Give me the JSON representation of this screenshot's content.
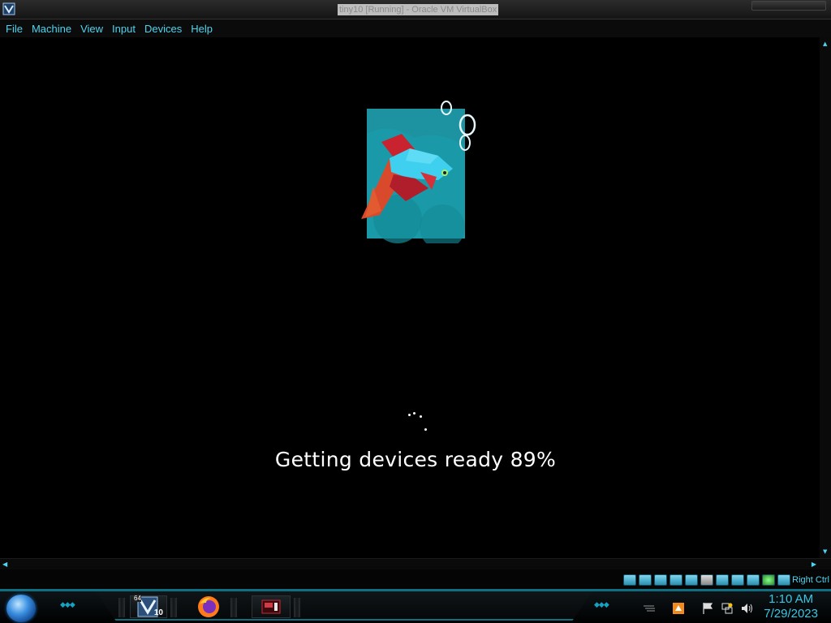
{
  "window": {
    "title": "tiny10 [Running] - Oracle VM VirtualBox",
    "app_icon": "virtualbox-icon"
  },
  "menubar": {
    "items": [
      "File",
      "Machine",
      "View",
      "Input",
      "Devices",
      "Help"
    ]
  },
  "vm_screen": {
    "artwork": "betta-fish-illustration",
    "status_text": "Getting devices ready 89%",
    "progress_percent": 89
  },
  "vbox_status": {
    "icons": [
      "hard-disk-icon",
      "optical-drive-icon",
      "audio-icon",
      "network-icon",
      "usb-icon",
      "shared-folder-icon",
      "display-icon",
      "recording-icon",
      "cpu-icon",
      "mouse-integration-icon",
      "keyboard-icon"
    ],
    "host_key": "Right Ctrl"
  },
  "taskbar": {
    "pinned": [
      {
        "name": "tiny10-64-icon",
        "badge_top": "64",
        "badge_bottom": "10"
      },
      {
        "name": "firefox-icon"
      },
      {
        "name": "media-player-icon"
      }
    ],
    "tray_icons": [
      "firefox-tray-icon",
      "flag-icon",
      "network-tray-icon",
      "volume-icon"
    ],
    "clock": {
      "time": "1:10 AM",
      "date": "7/29/2023"
    }
  },
  "colors": {
    "accent": "#4fd4ef",
    "fish_bg": "#1a9aa8",
    "fish_body": "#3fd0ef",
    "fish_fins": "#c8232f",
    "taskbar_accent": "#0e6f82"
  }
}
